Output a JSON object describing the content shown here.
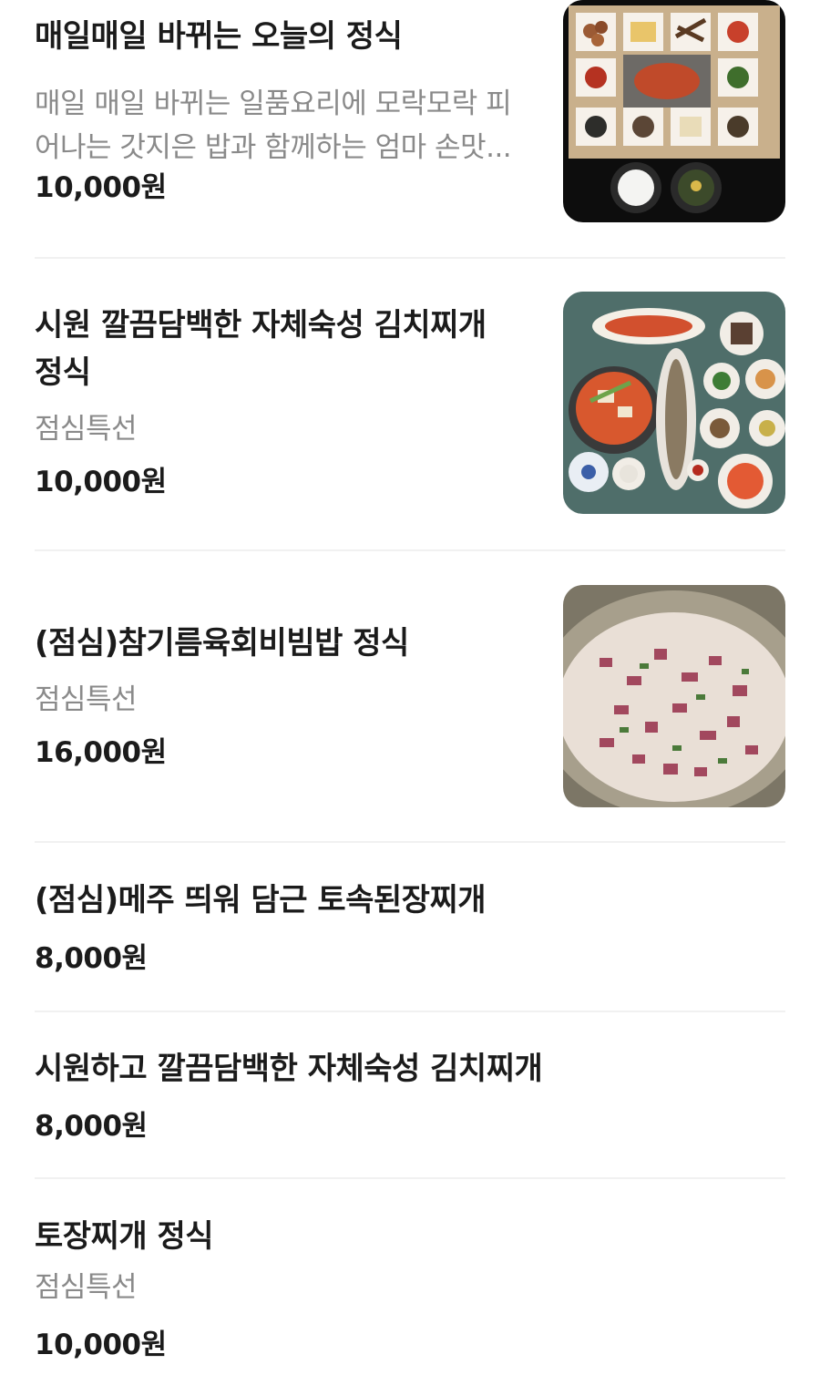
{
  "menu_items": [
    {
      "name": "매일매일 바뀌는 오늘의 정식",
      "description_line1": "매일 매일 바뀌는 일품요리에 모락모락 피",
      "description_line2": "어나는 갓지은 밥과 함께하는 엄마 손맛...",
      "price": "10,000원"
    },
    {
      "name_line1": "시원 깔끔담백한 자체숙성 김치찌개",
      "name_line2": "정식",
      "description": "점심특선",
      "price": "10,000원"
    },
    {
      "name": "(점심)참기름육회비빔밥 정식",
      "description": "점심특선",
      "price": "16,000원"
    },
    {
      "name": "(점심)메주 띄워 담근 토속된장찌개",
      "price": "8,000원"
    },
    {
      "name": "시원하고 깔끔담백한 자체숙성 김치찌개",
      "price": "8,000원"
    },
    {
      "name": "토장찌개 정식",
      "description": "점심특선",
      "price": "10,000원"
    }
  ]
}
